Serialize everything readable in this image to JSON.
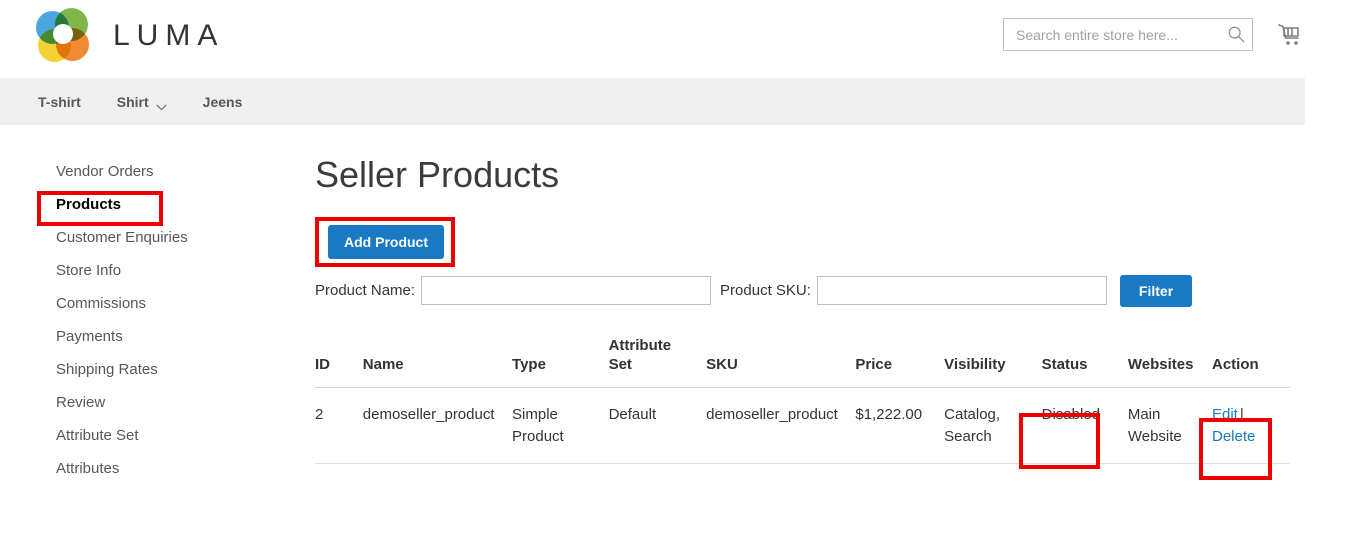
{
  "header": {
    "logo_text": "LUMA",
    "logo_icon": "luma-flower-logo",
    "search": {
      "placeholder": "Search entire store here...",
      "value": "",
      "icon": "search-icon"
    },
    "cart_icon": "shopping-cart-icon"
  },
  "nav": {
    "items": [
      {
        "label": "T-shirt",
        "has_dropdown": false
      },
      {
        "label": "Shirt",
        "has_dropdown": true
      },
      {
        "label": "Jeens",
        "has_dropdown": false
      }
    ]
  },
  "sidebar": {
    "items": [
      {
        "label": "Vendor Orders",
        "active": false
      },
      {
        "label": "Products",
        "active": true
      },
      {
        "label": "Customer Enquiries",
        "active": false
      },
      {
        "label": "Store Info",
        "active": false
      },
      {
        "label": "Commissions",
        "active": false
      },
      {
        "label": "Payments",
        "active": false
      },
      {
        "label": "Shipping Rates",
        "active": false
      },
      {
        "label": "Review",
        "active": false
      },
      {
        "label": "Attribute Set",
        "active": false
      },
      {
        "label": "Attributes",
        "active": false
      }
    ]
  },
  "main": {
    "title": "Seller Products",
    "add_product_label": "Add Product",
    "filter": {
      "product_name_label": "Product Name:",
      "product_name_value": "",
      "product_sku_label": "Product SKU:",
      "product_sku_value": "",
      "filter_button_label": "Filter"
    },
    "table": {
      "columns": [
        "ID",
        "Name",
        "Type",
        "Attribute Set",
        "SKU",
        "Price",
        "Visibility",
        "Status",
        "Websites",
        "Action"
      ],
      "rows": [
        {
          "id": "2",
          "name": "demoseller_product",
          "type": "Simple Product",
          "attribute_set": "Default",
          "sku": "demoseller_product",
          "price": "$1,222.00",
          "visibility": "Catalog, Search",
          "status": "Disabled",
          "websites": "Main Website",
          "action_edit": "Edit",
          "action_separator": "|",
          "action_delete": "Delete"
        }
      ]
    }
  },
  "highlights": {
    "color": "#ee0000",
    "targets": [
      "sidebar-products",
      "add-product-button",
      "status-cell",
      "action-cell"
    ]
  },
  "colors": {
    "primary_blue": "#1979c3",
    "nav_background": "#f0f0f0",
    "link_blue": "#1979c3",
    "highlight_red": "#ee0000"
  }
}
